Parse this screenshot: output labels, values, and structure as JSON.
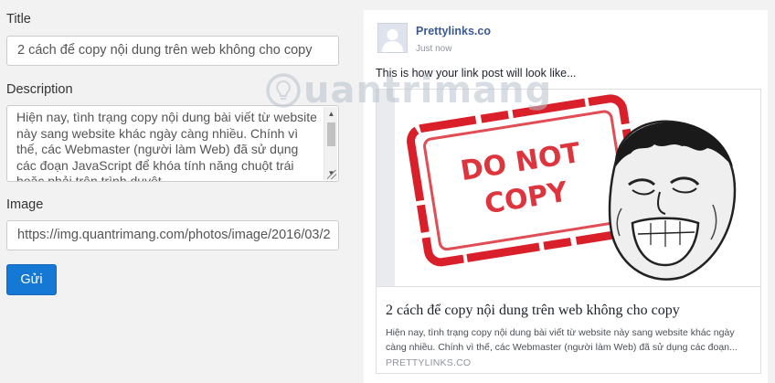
{
  "form": {
    "title_label": "Title",
    "title_value": "2 cách để copy nội dung trên web không cho copy",
    "description_label": "Description",
    "description_value": "Hiện nay, tình trạng copy nội dung bài viết từ website này sang website khác ngày càng nhiều. Chính vì thế, các Webmaster (người làm Web) đã sử dụng các đoạn JavaScript để khóa tính năng chuột trái hoặc phải trên trình duyệt.",
    "image_label": "Image",
    "image_value": "https://img.quantrimang.com/photos/image/2016/03/2",
    "submit_label": "Gửi"
  },
  "preview": {
    "page_name": "Prettylinks.co",
    "timestamp": "Just now",
    "post_text": "This is how your link post will look like...",
    "card": {
      "image_text_line1": "DO NOT",
      "image_text_line2": "COPY",
      "title": "2 cách để copy nội dung trên web không cho copy",
      "description": "Hiện nay, tình trạng copy nội dung bài viết từ website này sang website khác ngày càng nhiều. Chính vì thế, các Webmaster (người làm Web) đã sử dụng các đoạn...",
      "domain": "PRETTYLINKS.CO"
    }
  },
  "watermark": {
    "text": "uantrimang"
  },
  "colors": {
    "button_bg": "#1478d4",
    "facebook_blue": "#3b5998",
    "stamp_red": "#d9202a"
  },
  "icons": {
    "avatar": "default-avatar-icon",
    "watermark": "lightbulb-icon"
  }
}
